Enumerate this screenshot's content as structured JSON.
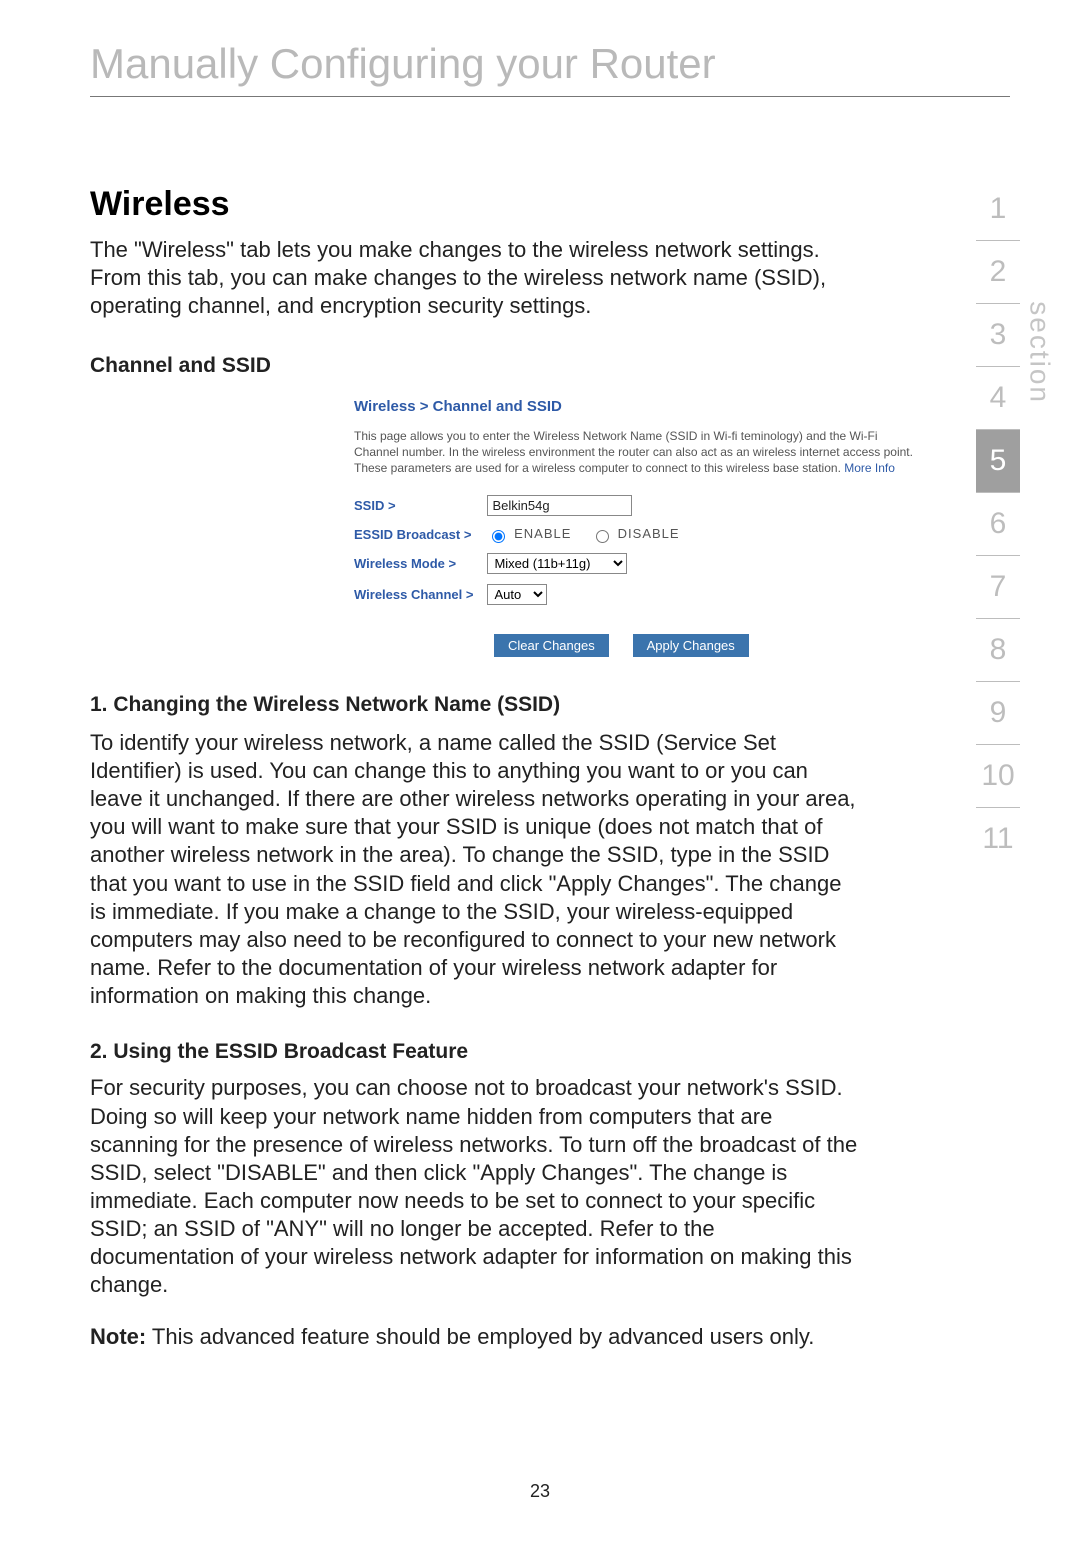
{
  "header": {
    "title": "Manually Configuring your Router"
  },
  "sectionNav": {
    "label": "section",
    "items": [
      "1",
      "2",
      "3",
      "4",
      "5",
      "6",
      "7",
      "8",
      "9",
      "10",
      "11"
    ],
    "active": "5"
  },
  "wireless": {
    "title": "Wireless",
    "intro": "The \"Wireless\" tab lets you make changes to the wireless network settings. From this tab, you can make changes to the wireless network name (SSID), operating channel, and encryption security settings.",
    "subheading": "Channel and SSID"
  },
  "panel": {
    "breadcrumb": "Wireless >  Channel and SSID",
    "description": "This page allows you to enter the Wireless Network Name (SSID in Wi-fi teminology) and the Wi-Fi Channel number. In the wireless environment the router can also act as an wireless internet access point. These parameters are used for a wireless computer to connect to this wireless base station. ",
    "moreInfo": "More Info",
    "rows": {
      "ssidLabel": "SSID >",
      "ssidValue": "Belkin54g",
      "essidLabel": "ESSID Broadcast >",
      "enable": "ENABLE",
      "disable": "DISABLE",
      "modeLabel": "Wireless Mode >",
      "modeValue": "Mixed (11b+11g)",
      "channelLabel": "Wireless Channel >",
      "channelValue": "Auto"
    },
    "buttons": {
      "clear": "Clear Changes",
      "apply": "Apply Changes"
    }
  },
  "sections": {
    "s1title": "1. Changing the Wireless Network Name (SSID)",
    "s1body": "To identify your wireless network, a name called the SSID (Service Set Identifier) is used. You can change this to anything you want to or you can leave it unchanged. If there are other wireless networks operating in your area, you will want to make sure that your SSID is unique (does not match that of another wireless network in the area). To change the SSID, type in the SSID that you want to use in the SSID field and click \"Apply Changes\". The change is immediate. If you make a change to the SSID, your wireless-equipped computers may also need to be reconfigured to connect to your new network name. Refer to the documentation of your wireless network adapter for information on making this change.",
    "s2title": "2. Using the ESSID Broadcast Feature",
    "s2body": "For security purposes, you can choose not to broadcast your network's SSID. Doing so will keep your network name hidden from computers that are scanning for the presence of wireless networks. To turn off the broadcast of the SSID, select \"DISABLE\" and then click \"Apply Changes\". The change is immediate. Each computer now needs to be set to connect to your specific SSID; an SSID of \"ANY\" will no longer be accepted. Refer to the documentation of your wireless network adapter for information on making this change.",
    "noteLabel": "Note:",
    "noteBody": " This advanced feature should be employed by advanced users only."
  },
  "pageNumber": "23"
}
